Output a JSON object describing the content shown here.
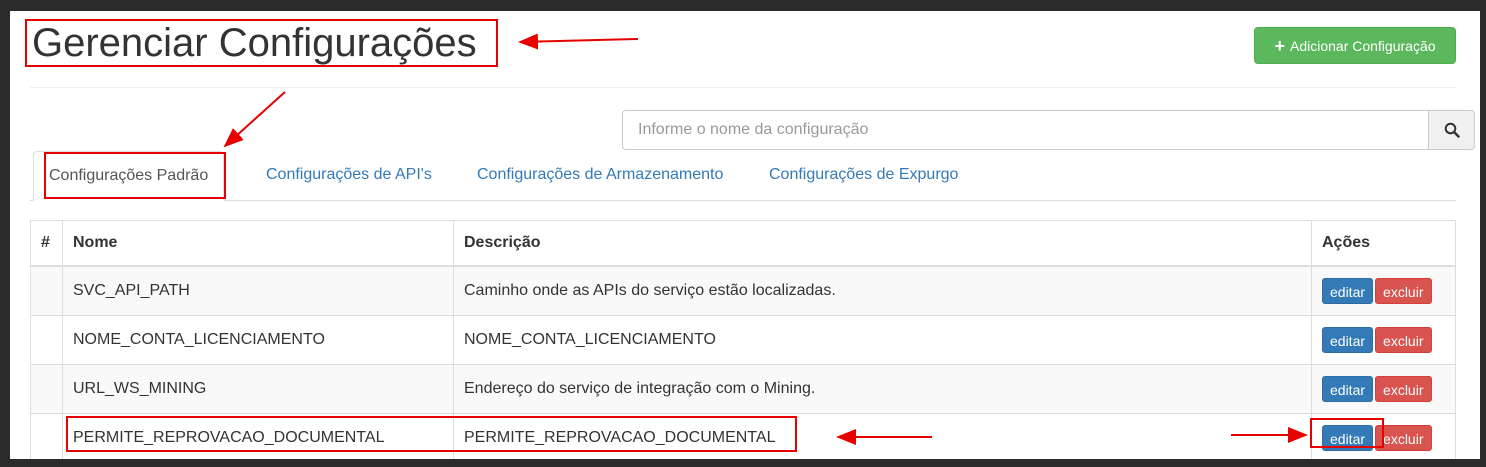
{
  "page": {
    "title": "Gerenciar Configurações",
    "add_button_label": "Adicionar Configuração"
  },
  "search": {
    "placeholder": "Informe o nome da configuração",
    "value": ""
  },
  "tabs": [
    {
      "label": "Configurações Padrão",
      "active": true
    },
    {
      "label": "Configurações de API's",
      "active": false
    },
    {
      "label": "Configurações de Armazenamento",
      "active": false
    },
    {
      "label": "Configurações de Expurgo",
      "active": false
    }
  ],
  "table": {
    "headers": {
      "num": "#",
      "nome": "Nome",
      "descricao": "Descrição",
      "acoes": "Ações"
    },
    "rows": [
      {
        "num": "",
        "nome": "SVC_API_PATH",
        "descricao": "Caminho onde as APIs do serviço estão localizadas.",
        "edit_label": "editar",
        "delete_label": "excluir"
      },
      {
        "num": "",
        "nome": "NOME_CONTA_LICENCIAMENTO",
        "descricao": "NOME_CONTA_LICENCIAMENTO",
        "edit_label": "editar",
        "delete_label": "excluir"
      },
      {
        "num": "",
        "nome": "URL_WS_MINING",
        "descricao": "Endereço do serviço de integração com o Mining.",
        "edit_label": "editar",
        "delete_label": "excluir"
      },
      {
        "num": "",
        "nome": "PERMITE_REPROVACAO_DOCUMENTAL",
        "descricao": "PERMITE_REPROVACAO_DOCUMENTAL",
        "edit_label": "editar",
        "delete_label": "excluir"
      }
    ]
  },
  "colors": {
    "primary": "#337ab7",
    "success": "#5cb85c",
    "danger": "#d9534f",
    "annotation": "#e60000"
  },
  "icons": {
    "add": "plus-icon",
    "search": "search-icon"
  }
}
